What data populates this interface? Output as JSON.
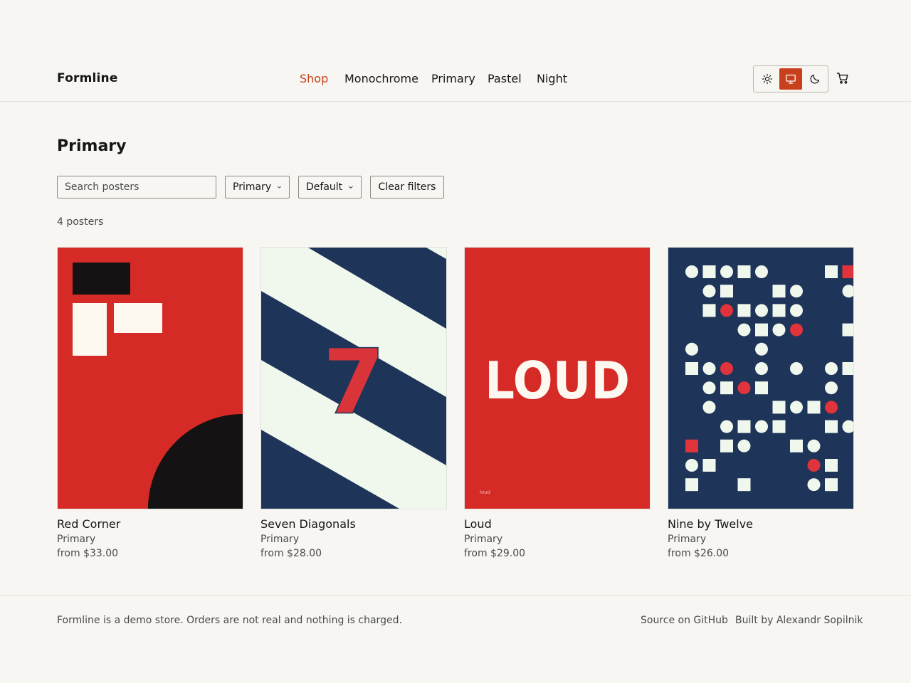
{
  "app": {
    "name": "Formline"
  },
  "nav": {
    "items": [
      {
        "label": "Shop",
        "active": true
      },
      {
        "label": "Monochrome",
        "active": false
      },
      {
        "label": "Primary",
        "active": false
      },
      {
        "label": "Pastel",
        "active": false
      },
      {
        "label": "Night",
        "active": false
      }
    ]
  },
  "theme": {
    "options": [
      {
        "icon": "sun-icon",
        "selected": false
      },
      {
        "icon": "monitor-icon",
        "selected": true
      },
      {
        "icon": "moon-icon",
        "selected": false
      }
    ]
  },
  "cart": {
    "icon": "cart-icon"
  },
  "page": {
    "title": "Primary",
    "search_placeholder": "Search posters",
    "filter_collection": "Primary",
    "filter_sort": "Default",
    "clear_label": "Clear filters",
    "count_label": "4 posters"
  },
  "products": [
    {
      "name": "Red Corner",
      "collection": "Primary",
      "price": "from $33.00"
    },
    {
      "name": "Seven Diagonals",
      "collection": "Primary",
      "price": "from $28.00",
      "poster_text": "7"
    },
    {
      "name": "Loud",
      "collection": "Primary",
      "price": "from $29.00",
      "poster_text": "LOUD",
      "poster_small_text": "loud"
    },
    {
      "name": "Nine by Twelve",
      "collection": "Primary",
      "price": "from $26.00"
    }
  ],
  "colors": {
    "accent": "#c8401c",
    "red": "#d52a26",
    "navy": "#1e3458",
    "cream": "#fdf8f0",
    "mint": "#f0f8ee",
    "black": "#141212"
  },
  "footer": {
    "note": "Formline is a demo store. Orders are not real and nothing is charged.",
    "links": [
      "Source on GitHub",
      "Built by Alexandr Sopilnik"
    ]
  }
}
